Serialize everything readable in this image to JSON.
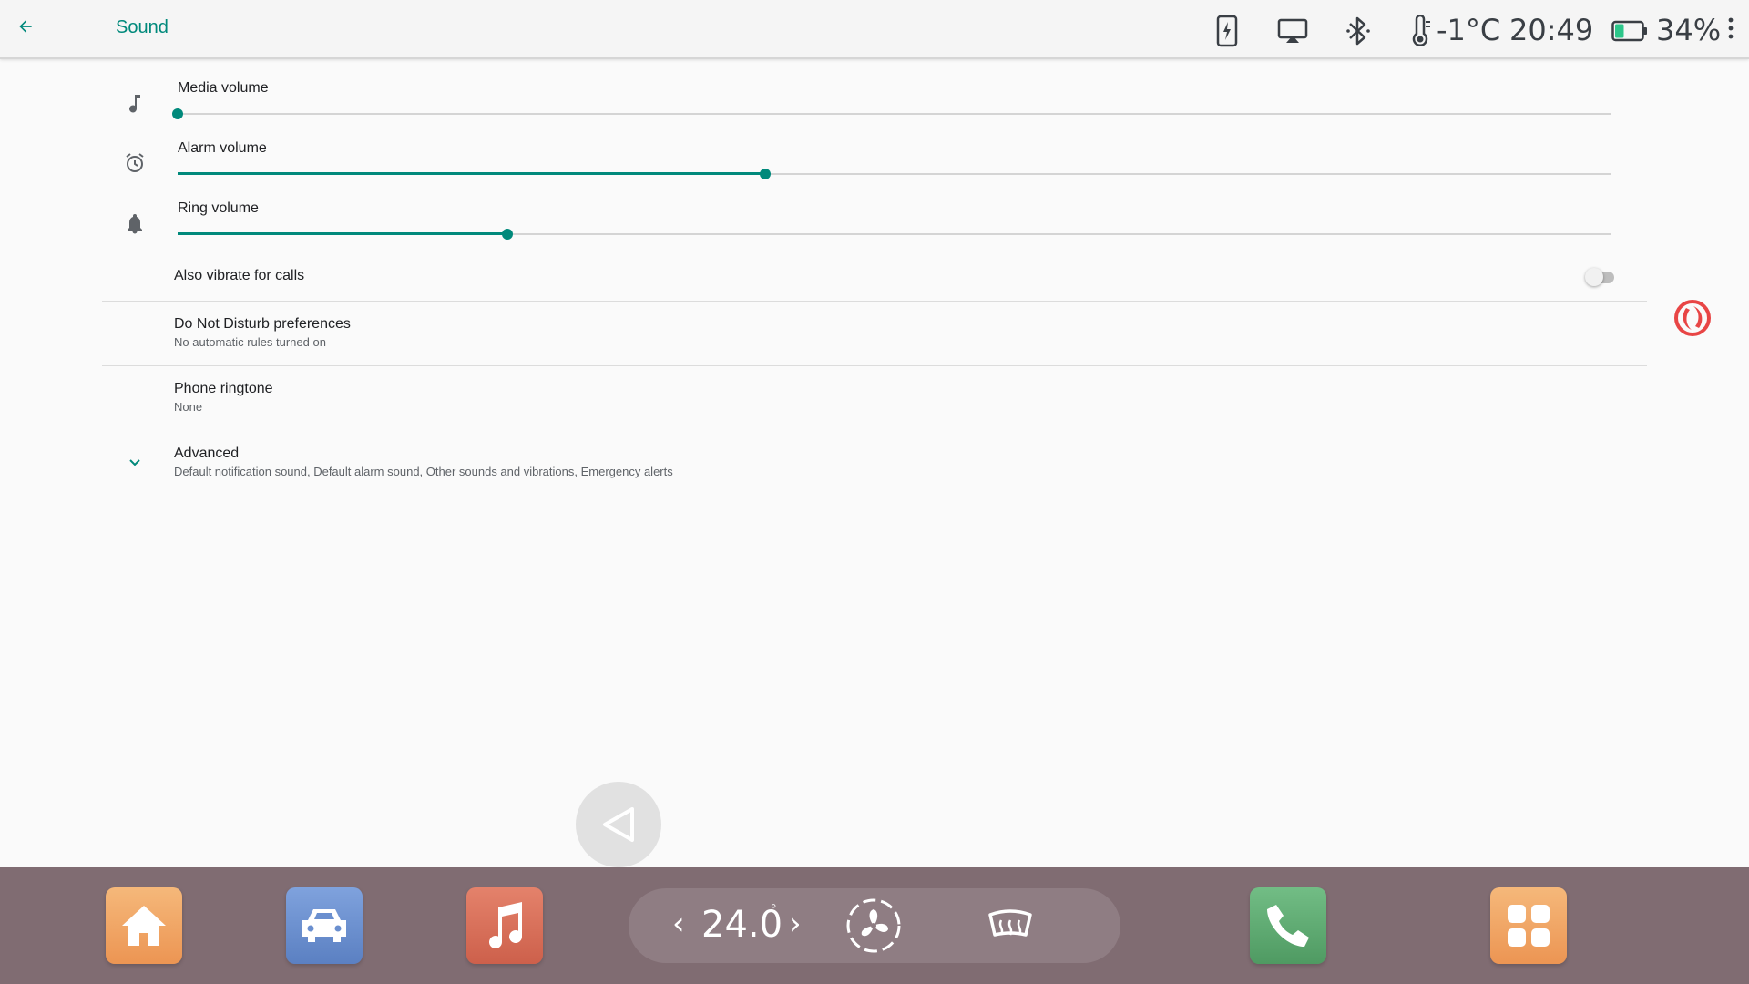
{
  "header": {
    "title": "Sound",
    "temperature": "-1°C",
    "time": "20:49",
    "battery": "34%",
    "battery_level": 0.34
  },
  "sliders": [
    {
      "label": "Media volume",
      "value": 0.0
    },
    {
      "label": "Alarm volume",
      "value": 0.41
    },
    {
      "label": "Ring volume",
      "value": 0.23
    }
  ],
  "vibrate": {
    "label": "Also vibrate for calls",
    "enabled": false
  },
  "dnd": {
    "title": "Do Not Disturb preferences",
    "subtitle": "No automatic rules turned on"
  },
  "ringtone": {
    "title": "Phone ringtone",
    "subtitle": "None"
  },
  "advanced": {
    "title": "Advanced",
    "subtitle": "Default notification sound, Default alarm sound, Other sounds and vibrations, Emergency alerts"
  },
  "climate": {
    "temperature": "24.0",
    "unit": "°",
    "left_arrow": "‹",
    "right_arrow": "›"
  },
  "colors": {
    "accent": "#00897b",
    "dock_bg": "#806c72",
    "climate_bg": "#8f7d83",
    "home_app": "#f0a060",
    "car_app": "#6a8fcf",
    "music_app": "#d8715b",
    "phone_app": "#5fae72",
    "apps_app": "#f0a060",
    "logo": "#e84545"
  },
  "icons": {
    "back": "arrow-left-icon",
    "media": "music-note-icon",
    "alarm": "alarm-clock-icon",
    "ring": "bell-icon",
    "advanced": "chevron-down-icon"
  }
}
